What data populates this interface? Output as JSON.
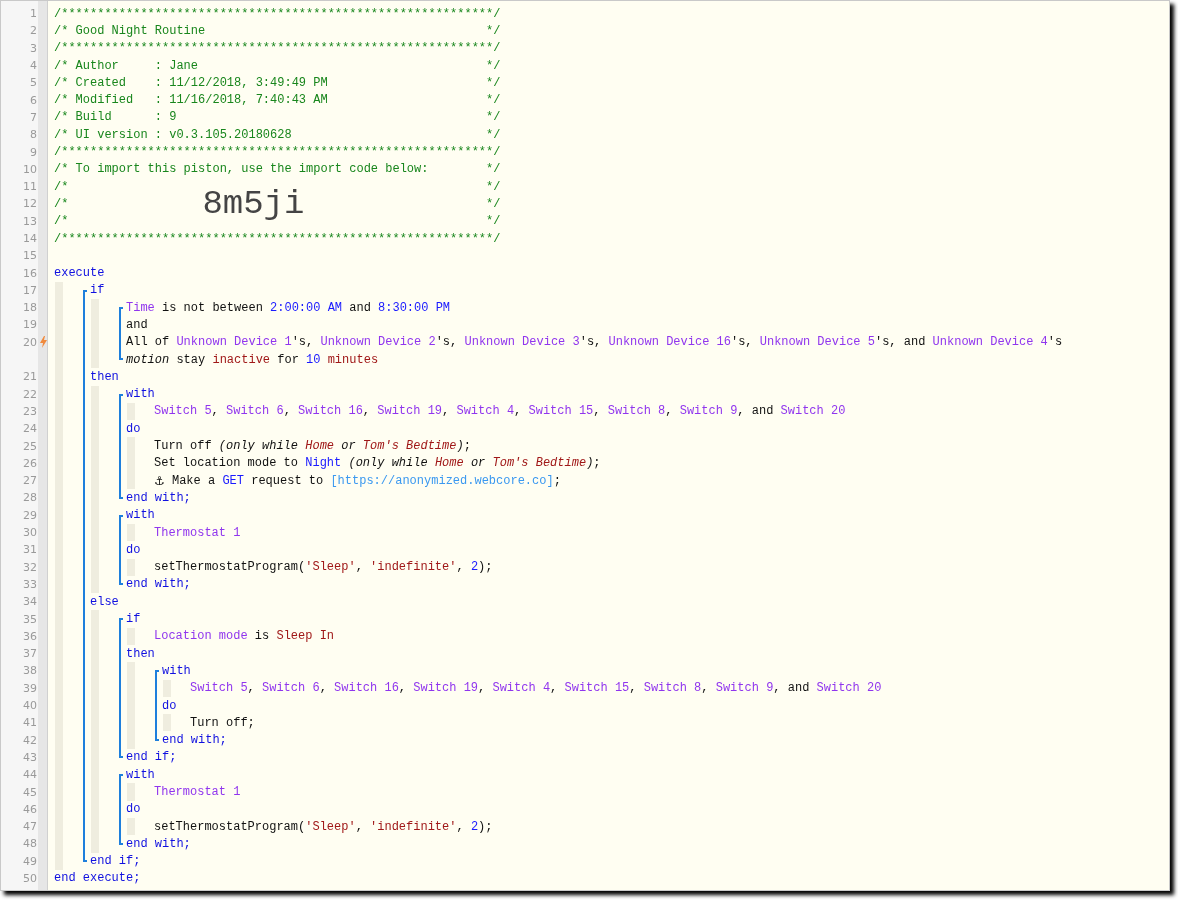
{
  "editor": {
    "lines": [
      {
        "kind": "comment",
        "num": "1",
        "flagged": false,
        "text": "/************************************************************/"
      },
      {
        "kind": "comment",
        "num": "2",
        "flagged": false,
        "text": "/* Good Night Routine",
        "end": "*/"
      },
      {
        "kind": "comment",
        "num": "3",
        "flagged": false,
        "text": "/************************************************************/"
      },
      {
        "kind": "comment",
        "num": "4",
        "flagged": false,
        "text": "/* Author     : Jane",
        "end": "*/"
      },
      {
        "kind": "comment",
        "num": "5",
        "flagged": false,
        "text": "/* Created    : 11/12/2018, 3:49:49 PM",
        "end": "*/"
      },
      {
        "kind": "comment",
        "num": "6",
        "flagged": false,
        "text": "/* Modified   : 11/16/2018, 7:40:43 AM",
        "end": "*/"
      },
      {
        "kind": "comment",
        "num": "7",
        "flagged": false,
        "text": "/* Build      : 9",
        "end": "*/"
      },
      {
        "kind": "comment",
        "num": "8",
        "flagged": false,
        "text": "/* UI version : v0.3.105.20180628",
        "end": "*/"
      },
      {
        "kind": "comment",
        "num": "9",
        "flagged": false,
        "text": "/************************************************************/"
      },
      {
        "kind": "comment",
        "num": "10",
        "flagged": false,
        "text": "/* To import this piston, use the import code below:",
        "end": "*/"
      },
      {
        "kind": "comment",
        "num": "11",
        "flagged": false,
        "text": "/*",
        "end": "*/"
      },
      {
        "kind": "comment",
        "num": "12",
        "flagged": false,
        "text": "/*",
        "code": "8m5ji",
        "end": "*/"
      },
      {
        "kind": "comment",
        "num": "13",
        "flagged": false,
        "text": "/*",
        "end": "*/"
      },
      {
        "kind": "comment",
        "num": "14",
        "flagged": false,
        "text": "/************************************************************/"
      },
      {
        "kind": "line",
        "num": "15",
        "flagged": false
      },
      {
        "kind": "line",
        "num": "16",
        "flagged": false,
        "tokens": [
          {
            "kind": "keyword",
            "text": "execute"
          }
        ]
      },
      {
        "kind": "guide",
        "items": [
          {
            "kind": "bracket",
            "items": [
              {
                "kind": "line",
                "num": "17",
                "flagged": false,
                "tokens": [
                  {
                    "kind": "keyword",
                    "text": "if"
                  }
                ]
              },
              {
                "kind": "guide",
                "items": [
                  {
                    "kind": "bracket",
                    "items": [
                      {
                        "kind": "line",
                        "num": "18",
                        "flagged": false,
                        "tokens": [
                          {
                            "kind": "device",
                            "text": "Time"
                          },
                          {
                            "kind": "text",
                            "text": " is not between "
                          },
                          {
                            "kind": "value",
                            "text": "2:00:00 AM"
                          },
                          {
                            "kind": "text",
                            "text": " and "
                          },
                          {
                            "kind": "value",
                            "text": "8:30:00 PM"
                          }
                        ]
                      },
                      {
                        "kind": "line",
                        "num": "19",
                        "flagged": false,
                        "tokens": [
                          {
                            "kind": "text",
                            "text": "and"
                          }
                        ]
                      },
                      {
                        "kind": "line",
                        "num": "20",
                        "flagged": true,
                        "tokens": [
                          {
                            "kind": "text",
                            "text": "All of "
                          },
                          {
                            "kind": "device",
                            "text": "Unknown Device 1"
                          },
                          {
                            "kind": "text",
                            "text": "'s, "
                          },
                          {
                            "kind": "device",
                            "text": "Unknown Device 2"
                          },
                          {
                            "kind": "text",
                            "text": "'s, "
                          },
                          {
                            "kind": "device",
                            "text": "Unknown Device 3"
                          },
                          {
                            "kind": "text",
                            "text": "'s, "
                          },
                          {
                            "kind": "device",
                            "text": "Unknown Device 16"
                          },
                          {
                            "kind": "text",
                            "text": "'s, "
                          },
                          {
                            "kind": "device",
                            "text": "Unknown Device 5"
                          },
                          {
                            "kind": "text",
                            "text": "'s, and "
                          },
                          {
                            "kind": "device",
                            "text": "Unknown Device 4"
                          },
                          {
                            "kind": "text",
                            "text": "'s"
                          }
                        ]
                      },
                      {
                        "kind": "line",
                        "flagged": false,
                        "tokens": [
                          {
                            "kind": "italic",
                            "text": "motion"
                          },
                          {
                            "kind": "text",
                            "text": " stay "
                          },
                          {
                            "kind": "literal",
                            "text": "inactive"
                          },
                          {
                            "kind": "text",
                            "text": " for "
                          },
                          {
                            "kind": "value",
                            "text": "10"
                          },
                          {
                            "kind": "literal",
                            "text": " minutes"
                          }
                        ]
                      }
                    ]
                  }
                ]
              },
              {
                "kind": "line",
                "num": "21",
                "flagged": false,
                "tokens": [
                  {
                    "kind": "keyword",
                    "text": "then"
                  }
                ]
              },
              {
                "kind": "guide",
                "items": [
                  {
                    "kind": "bracket",
                    "items": [
                      {
                        "kind": "line",
                        "num": "22",
                        "flagged": false,
                        "tokens": [
                          {
                            "kind": "keyword",
                            "text": "with"
                          }
                        ]
                      },
                      {
                        "kind": "guide",
                        "items": [
                          {
                            "kind": "line",
                            "num": "23",
                            "flagged": false,
                            "tokens": [
                              {
                                "kind": "device",
                                "text": "Switch 5"
                              },
                              {
                                "kind": "text",
                                "text": ", "
                              },
                              {
                                "kind": "device",
                                "text": "Switch 6"
                              },
                              {
                                "kind": "text",
                                "text": ", "
                              },
                              {
                                "kind": "device",
                                "text": "Switch 16"
                              },
                              {
                                "kind": "text",
                                "text": ", "
                              },
                              {
                                "kind": "device",
                                "text": "Switch 19"
                              },
                              {
                                "kind": "text",
                                "text": ", "
                              },
                              {
                                "kind": "device",
                                "text": "Switch 4"
                              },
                              {
                                "kind": "text",
                                "text": ", "
                              },
                              {
                                "kind": "device",
                                "text": "Switch 15"
                              },
                              {
                                "kind": "text",
                                "text": ", "
                              },
                              {
                                "kind": "device",
                                "text": "Switch 8"
                              },
                              {
                                "kind": "text",
                                "text": ", "
                              },
                              {
                                "kind": "device",
                                "text": "Switch 9"
                              },
                              {
                                "kind": "text",
                                "text": ", and "
                              },
                              {
                                "kind": "device",
                                "text": "Switch 20"
                              }
                            ]
                          }
                        ]
                      },
                      {
                        "kind": "line",
                        "num": "24",
                        "flagged": false,
                        "tokens": [
                          {
                            "kind": "keyword",
                            "text": "do"
                          }
                        ]
                      },
                      {
                        "kind": "guide",
                        "items": [
                          {
                            "kind": "line",
                            "num": "25",
                            "flagged": false,
                            "tokens": [
                              {
                                "kind": "text",
                                "text": "Turn off "
                              },
                              {
                                "kind": "italic",
                                "text": "(only while "
                              },
                              {
                                "kind": "italic-literal",
                                "text": "Home"
                              },
                              {
                                "kind": "italic",
                                "text": " or "
                              },
                              {
                                "kind": "italic-literal",
                                "text": "Tom's Bedtime"
                              },
                              {
                                "kind": "italic",
                                "text": ")"
                              },
                              {
                                "kind": "text",
                                "text": ";"
                              }
                            ]
                          },
                          {
                            "kind": "line",
                            "num": "26",
                            "flagged": false,
                            "tokens": [
                              {
                                "kind": "text",
                                "text": "Set location mode to "
                              },
                              {
                                "kind": "value",
                                "text": "Night"
                              },
                              {
                                "kind": "italic",
                                "text": " (only while "
                              },
                              {
                                "kind": "italic-literal",
                                "text": "Home"
                              },
                              {
                                "kind": "italic",
                                "text": " or "
                              },
                              {
                                "kind": "italic-literal",
                                "text": "Tom's Bedtime"
                              },
                              {
                                "kind": "italic",
                                "text": ")"
                              },
                              {
                                "kind": "text",
                                "text": ";"
                              }
                            ]
                          },
                          {
                            "kind": "line",
                            "num": "27",
                            "flagged": false,
                            "tokens": [
                              {
                                "kind": "icon",
                                "text": "⚓"
                              },
                              {
                                "kind": "text",
                                "text": " Make a "
                              },
                              {
                                "kind": "value",
                                "text": "GET"
                              },
                              {
                                "kind": "text",
                                "text": " request to "
                              },
                              {
                                "kind": "url",
                                "text": "[https://anonymized.webcore.co]"
                              },
                              {
                                "kind": "text",
                                "text": ";"
                              }
                            ]
                          }
                        ]
                      },
                      {
                        "kind": "line",
                        "num": "28",
                        "flagged": false,
                        "tokens": [
                          {
                            "kind": "keyword",
                            "text": "end with;"
                          }
                        ]
                      }
                    ]
                  },
                  {
                    "kind": "bracket",
                    "items": [
                      {
                        "kind": "line",
                        "num": "29",
                        "flagged": false,
                        "tokens": [
                          {
                            "kind": "keyword",
                            "text": "with"
                          }
                        ]
                      },
                      {
                        "kind": "guide",
                        "items": [
                          {
                            "kind": "line",
                            "num": "30",
                            "flagged": false,
                            "tokens": [
                              {
                                "kind": "device",
                                "text": "Thermostat 1"
                              }
                            ]
                          }
                        ]
                      },
                      {
                        "kind": "line",
                        "num": "31",
                        "flagged": false,
                        "tokens": [
                          {
                            "kind": "keyword",
                            "text": "do"
                          }
                        ]
                      },
                      {
                        "kind": "guide",
                        "items": [
                          {
                            "kind": "line",
                            "num": "32",
                            "flagged": false,
                            "tokens": [
                              {
                                "kind": "text",
                                "text": "setThermostatProgram("
                              },
                              {
                                "kind": "literal",
                                "text": "'Sleep'"
                              },
                              {
                                "kind": "text",
                                "text": ", "
                              },
                              {
                                "kind": "literal",
                                "text": "'indefinite'"
                              },
                              {
                                "kind": "text",
                                "text": ", "
                              },
                              {
                                "kind": "value",
                                "text": "2"
                              },
                              {
                                "kind": "text",
                                "text": ");"
                              }
                            ]
                          }
                        ]
                      },
                      {
                        "kind": "line",
                        "num": "33",
                        "flagged": false,
                        "tokens": [
                          {
                            "kind": "keyword",
                            "text": "end with;"
                          }
                        ]
                      }
                    ]
                  }
                ]
              },
              {
                "kind": "line",
                "num": "34",
                "flagged": false,
                "tokens": [
                  {
                    "kind": "keyword",
                    "text": "else"
                  }
                ]
              },
              {
                "kind": "guide",
                "items": [
                  {
                    "kind": "bracket",
                    "items": [
                      {
                        "kind": "line",
                        "num": "35",
                        "flagged": false,
                        "tokens": [
                          {
                            "kind": "keyword",
                            "text": "if"
                          }
                        ]
                      },
                      {
                        "kind": "guide",
                        "items": [
                          {
                            "kind": "line",
                            "num": "36",
                            "flagged": false,
                            "tokens": [
                              {
                                "kind": "device",
                                "text": "Location mode"
                              },
                              {
                                "kind": "text",
                                "text": " is "
                              },
                              {
                                "kind": "literal",
                                "text": "Sleep In"
                              }
                            ]
                          }
                        ]
                      },
                      {
                        "kind": "line",
                        "num": "37",
                        "flagged": false,
                        "tokens": [
                          {
                            "kind": "keyword",
                            "text": "then"
                          }
                        ]
                      },
                      {
                        "kind": "guide",
                        "items": [
                          {
                            "kind": "bracket",
                            "items": [
                              {
                                "kind": "line",
                                "num": "38",
                                "flagged": false,
                                "tokens": [
                                  {
                                    "kind": "keyword",
                                    "text": "with"
                                  }
                                ]
                              },
                              {
                                "kind": "guide",
                                "items": [
                                  {
                                    "kind": "line",
                                    "num": "39",
                                    "flagged": false,
                                    "tokens": [
                                      {
                                        "kind": "device",
                                        "text": "Switch 5"
                                      },
                                      {
                                        "kind": "text",
                                        "text": ", "
                                      },
                                      {
                                        "kind": "device",
                                        "text": "Switch 6"
                                      },
                                      {
                                        "kind": "text",
                                        "text": ", "
                                      },
                                      {
                                        "kind": "device",
                                        "text": "Switch 16"
                                      },
                                      {
                                        "kind": "text",
                                        "text": ", "
                                      },
                                      {
                                        "kind": "device",
                                        "text": "Switch 19"
                                      },
                                      {
                                        "kind": "text",
                                        "text": ", "
                                      },
                                      {
                                        "kind": "device",
                                        "text": "Switch 4"
                                      },
                                      {
                                        "kind": "text",
                                        "text": ", "
                                      },
                                      {
                                        "kind": "device",
                                        "text": "Switch 15"
                                      },
                                      {
                                        "kind": "text",
                                        "text": ", "
                                      },
                                      {
                                        "kind": "device",
                                        "text": "Switch 8"
                                      },
                                      {
                                        "kind": "text",
                                        "text": ", "
                                      },
                                      {
                                        "kind": "device",
                                        "text": "Switch 9"
                                      },
                                      {
                                        "kind": "text",
                                        "text": ", and "
                                      },
                                      {
                                        "kind": "device",
                                        "text": "Switch 20"
                                      }
                                    ]
                                  }
                                ]
                              },
                              {
                                "kind": "line",
                                "num": "40",
                                "flagged": false,
                                "tokens": [
                                  {
                                    "kind": "keyword",
                                    "text": "do"
                                  }
                                ]
                              },
                              {
                                "kind": "guide",
                                "items": [
                                  {
                                    "kind": "line",
                                    "num": "41",
                                    "flagged": false,
                                    "tokens": [
                                      {
                                        "kind": "text",
                                        "text": "Turn off;"
                                      }
                                    ]
                                  }
                                ]
                              },
                              {
                                "kind": "line",
                                "num": "42",
                                "flagged": false,
                                "tokens": [
                                  {
                                    "kind": "keyword",
                                    "text": "end with;"
                                  }
                                ]
                              }
                            ]
                          }
                        ]
                      },
                      {
                        "kind": "line",
                        "num": "43",
                        "flagged": false,
                        "tokens": [
                          {
                            "kind": "keyword",
                            "text": "end if;"
                          }
                        ]
                      }
                    ]
                  },
                  {
                    "kind": "bracket",
                    "items": [
                      {
                        "kind": "line",
                        "num": "44",
                        "flagged": false,
                        "tokens": [
                          {
                            "kind": "keyword",
                            "text": "with"
                          }
                        ]
                      },
                      {
                        "kind": "guide",
                        "items": [
                          {
                            "kind": "line",
                            "num": "45",
                            "flagged": false,
                            "tokens": [
                              {
                                "kind": "device",
                                "text": "Thermostat 1"
                              }
                            ]
                          }
                        ]
                      },
                      {
                        "kind": "line",
                        "num": "46",
                        "flagged": false,
                        "tokens": [
                          {
                            "kind": "keyword",
                            "text": "do"
                          }
                        ]
                      },
                      {
                        "kind": "guide",
                        "items": [
                          {
                            "kind": "line",
                            "num": "47",
                            "flagged": false,
                            "tokens": [
                              {
                                "kind": "text",
                                "text": "setThermostatProgram("
                              },
                              {
                                "kind": "literal",
                                "text": "'Sleep'"
                              },
                              {
                                "kind": "text",
                                "text": ", "
                              },
                              {
                                "kind": "literal",
                                "text": "'indefinite'"
                              },
                              {
                                "kind": "text",
                                "text": ", "
                              },
                              {
                                "kind": "value",
                                "text": "2"
                              },
                              {
                                "kind": "text",
                                "text": ");"
                              }
                            ]
                          }
                        ]
                      },
                      {
                        "kind": "line",
                        "num": "48",
                        "flagged": false,
                        "tokens": [
                          {
                            "kind": "keyword",
                            "text": "end with;"
                          }
                        ]
                      }
                    ]
                  }
                ]
              },
              {
                "kind": "line",
                "num": "49",
                "flagged": false,
                "tokens": [
                  {
                    "kind": "keyword",
                    "text": "end if;"
                  }
                ]
              }
            ]
          }
        ]
      },
      {
        "kind": "line",
        "num": "50",
        "flagged": false,
        "tokens": [
          {
            "kind": "keyword",
            "text": "end execute;"
          }
        ]
      }
    ]
  }
}
